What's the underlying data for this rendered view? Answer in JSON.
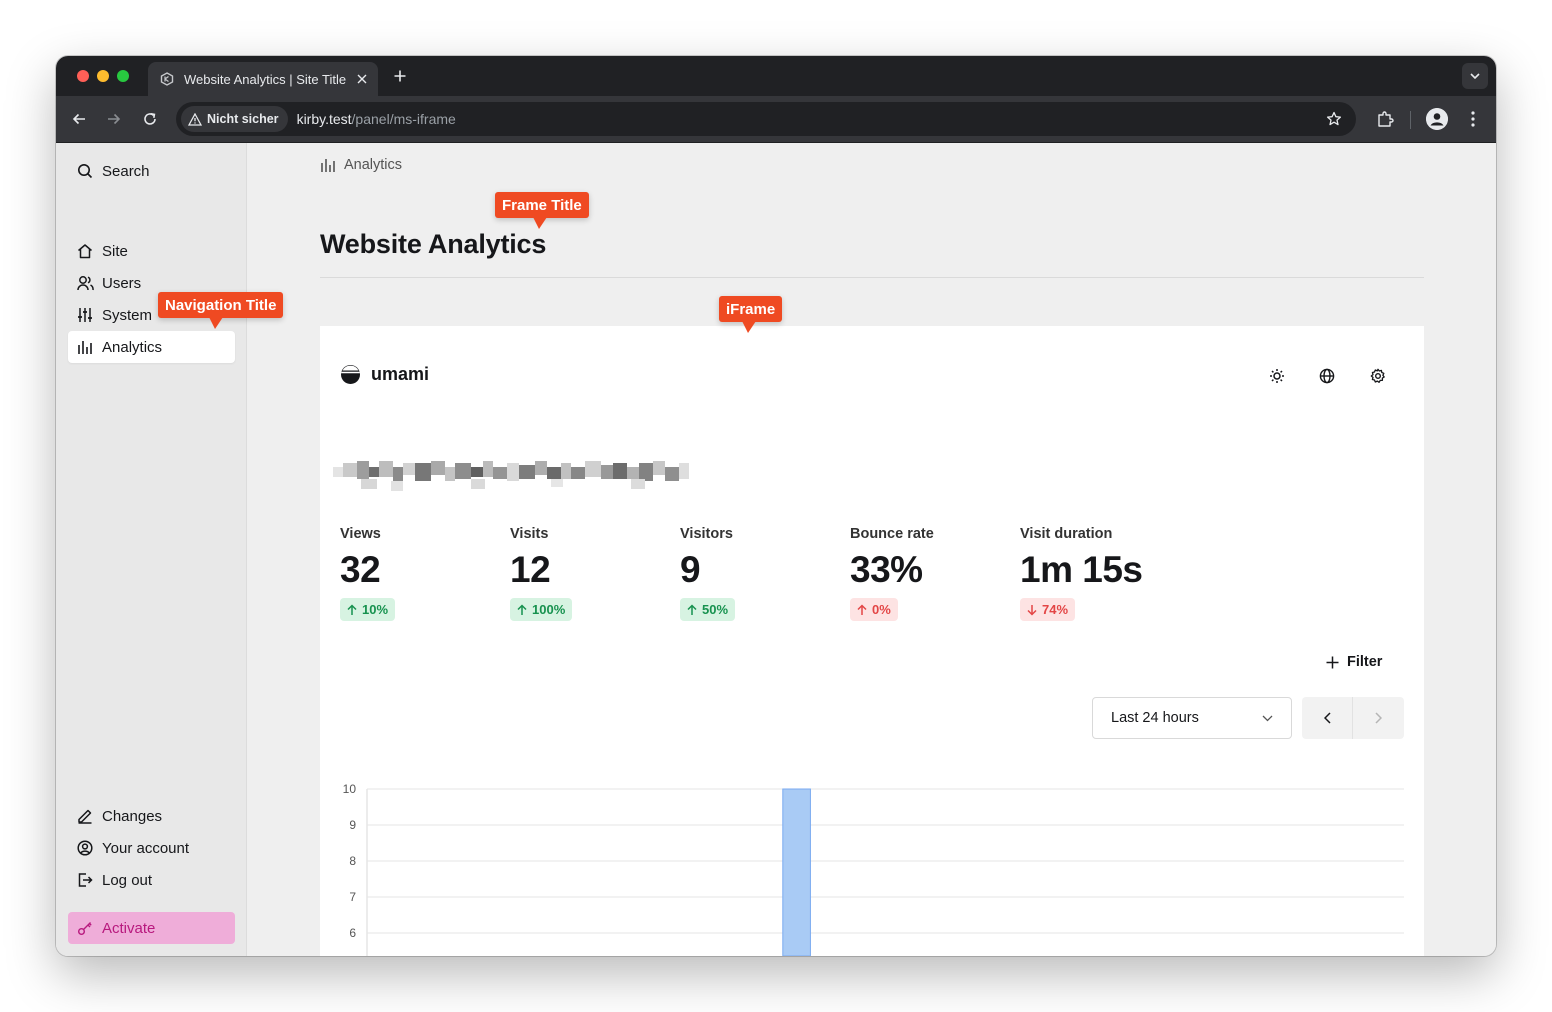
{
  "browser": {
    "tab_title": "Website Analytics | Site Title",
    "new_tab_symbol": "+",
    "security_label": "Nicht sicher",
    "url_host": "kirby.test",
    "url_path": "/panel/ms-iframe"
  },
  "sidebar": {
    "search_label": "Search",
    "items": [
      {
        "label": "Site",
        "icon": "home-icon"
      },
      {
        "label": "Users",
        "icon": "users-icon"
      },
      {
        "label": "System",
        "icon": "sliders-icon"
      },
      {
        "label": "Analytics",
        "icon": "bar-chart-icon",
        "active": true
      }
    ],
    "bottom_items": [
      {
        "label": "Changes",
        "icon": "pen-icon"
      },
      {
        "label": "Your account",
        "icon": "account-icon"
      },
      {
        "label": "Log out",
        "icon": "logout-icon"
      }
    ],
    "activate_label": "Activate"
  },
  "main": {
    "breadcrumb": "Analytics",
    "title": "Website Analytics"
  },
  "umami": {
    "brand": "umami",
    "metrics": [
      {
        "label": "Views",
        "value": "32",
        "change": "10%",
        "direction": "up"
      },
      {
        "label": "Visits",
        "value": "12",
        "change": "100%",
        "direction": "up"
      },
      {
        "label": "Visitors",
        "value": "9",
        "change": "50%",
        "direction": "up"
      },
      {
        "label": "Bounce rate",
        "value": "33%",
        "change": "0%",
        "direction": "up-negative"
      },
      {
        "label": "Visit duration",
        "value": "1m 15s",
        "change": "74%",
        "direction": "down"
      }
    ],
    "filter_label": "Filter",
    "range_label": "Last 24 hours"
  },
  "annotations": {
    "frame_title": "Frame Title",
    "navigation_title": "Navigation Title",
    "iframe": "iFrame"
  },
  "colors": {
    "accent_annotation": "#ef4a22",
    "bar": "#a9cbf5",
    "bar_stroke": "#7aaaf0",
    "positive": "#17924f",
    "negative": "#e34646",
    "activate": "#efadd9"
  },
  "chart_data": {
    "type": "bar",
    "y_ticks": [
      10,
      9,
      8,
      7,
      6
    ],
    "ylim_visible": [
      6,
      10
    ],
    "series": [
      {
        "values": [
          0,
          0,
          0,
          0,
          0,
          0,
          0,
          0,
          0,
          0,
          0,
          0,
          0,
          0,
          10,
          0,
          0,
          0,
          0,
          0,
          0,
          0,
          0,
          0,
          0,
          0,
          0,
          0,
          0,
          0,
          0,
          0,
          0,
          0,
          0
        ]
      }
    ],
    "grid": true,
    "legend": "none"
  }
}
